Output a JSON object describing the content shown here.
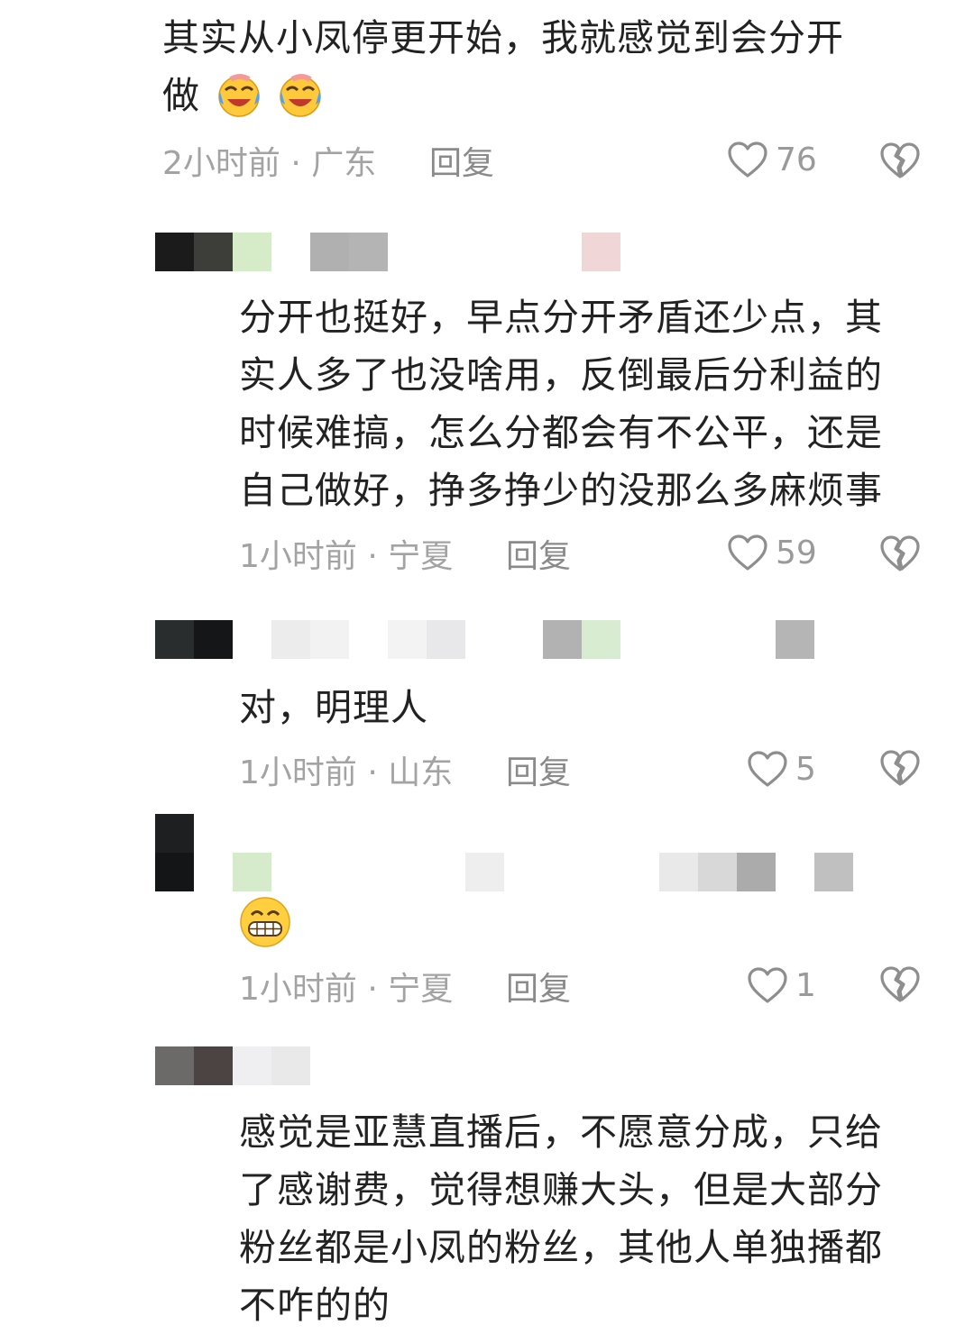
{
  "comments": [
    {
      "text_lines": [
        "其实从小凤停更开始，我就感觉到会分开",
        "做"
      ],
      "emoji": "laughing-crying-emoji",
      "time_location": "2小时前 · 广东",
      "reply_label": "回复",
      "likes": "76"
    },
    {
      "text_lines": [
        "分开也挺好，早点分开矛盾还少点，其",
        "实人多了也没啥用，反倒最后分利益的",
        "时候难搞，怎么分都会有不公平，还是",
        "自己做好，挣多挣少的没那么多麻烦事"
      ],
      "time_location": "1小时前 · 宁夏",
      "reply_label": "回复",
      "likes": "59"
    },
    {
      "text_lines": [
        "对，明理人"
      ],
      "time_location": "1小时前 · 山东",
      "reply_label": "回复",
      "likes": "5"
    },
    {
      "emoji": "grinning-emoji",
      "time_location": "1小时前 · 宁夏",
      "reply_label": "回复",
      "likes": "1"
    },
    {
      "text_lines": [
        "感觉是亚慧直播后，不愿意分成，只给",
        "了感谢费，觉得想赚大头，但是大部分",
        "粉丝都是小凤的粉丝，其他人单独播都",
        "不咋的的"
      ]
    }
  ],
  "icons": {
    "like": "heart-outline-icon",
    "dislike": "broken-heart-icon"
  },
  "colors": {
    "text": "#222222",
    "meta": "#a3a3a3",
    "reply": "#8a8a8a",
    "icon": "#8e8e8e"
  }
}
